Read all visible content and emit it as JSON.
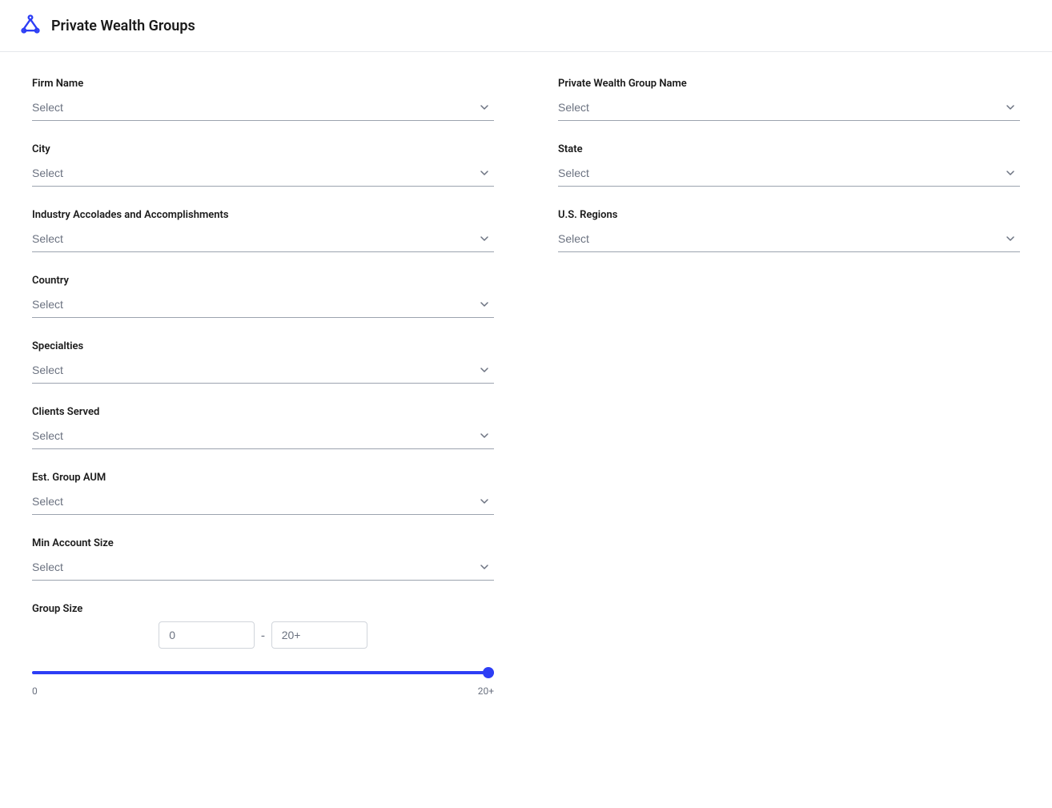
{
  "header": {
    "title": "Private Wealth Groups",
    "icon_label": "network-icon"
  },
  "form": {
    "fields": [
      {
        "id": "firm-name",
        "label": "Firm Name",
        "placeholder": "Select",
        "column": "left"
      },
      {
        "id": "private-wealth-group-name",
        "label": "Private Wealth Group Name",
        "placeholder": "Select",
        "column": "right"
      },
      {
        "id": "city",
        "label": "City",
        "placeholder": "Select",
        "column": "left"
      },
      {
        "id": "state",
        "label": "State",
        "placeholder": "Select",
        "column": "right"
      },
      {
        "id": "industry-accolades",
        "label": "Industry Accolades and Accomplishments",
        "placeholder": "Select",
        "column": "left"
      },
      {
        "id": "us-regions",
        "label": "U.S. Regions",
        "placeholder": "Select",
        "column": "right"
      },
      {
        "id": "country",
        "label": "Country",
        "placeholder": "Select",
        "column": "left"
      },
      {
        "id": "specialties",
        "label": "Specialties",
        "placeholder": "Select",
        "column": "left"
      },
      {
        "id": "clients-served",
        "label": "Clients Served",
        "placeholder": "Select",
        "column": "left"
      },
      {
        "id": "est-group-aum",
        "label": "Est. Group AUM",
        "placeholder": "Select",
        "column": "left"
      },
      {
        "id": "min-account-size",
        "label": "Min Account Size",
        "placeholder": "Select",
        "column": "left"
      }
    ],
    "group_size": {
      "label": "Group Size",
      "min_value": "0",
      "max_value": "20+",
      "min_label": "0",
      "max_label": "20+",
      "range_min": "0",
      "range_max": "100"
    }
  },
  "chevron_char": "⌄"
}
